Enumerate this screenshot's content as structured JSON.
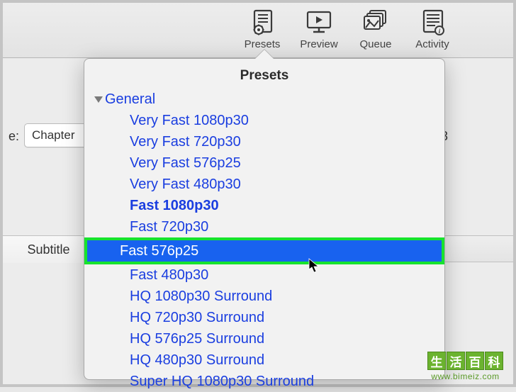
{
  "toolbar": {
    "items": [
      {
        "label": "Presets"
      },
      {
        "label": "Preview"
      },
      {
        "label": "Queue"
      },
      {
        "label": "Activity"
      }
    ]
  },
  "background": {
    "field_label": "e:",
    "chapter_label": "Chapter",
    "right_value": "3",
    "tab_label": "Subtitle"
  },
  "popover": {
    "title": "Presets",
    "category": "General",
    "items": [
      {
        "label": "Very Fast 1080p30",
        "bold": false,
        "selected": false
      },
      {
        "label": "Very Fast 720p30",
        "bold": false,
        "selected": false
      },
      {
        "label": "Very Fast 576p25",
        "bold": false,
        "selected": false
      },
      {
        "label": "Very Fast 480p30",
        "bold": false,
        "selected": false
      },
      {
        "label": "Fast 1080p30",
        "bold": true,
        "selected": false
      },
      {
        "label": "Fast 720p30",
        "bold": false,
        "selected": false
      },
      {
        "label": "Fast 576p25",
        "bold": false,
        "selected": true
      },
      {
        "label": "Fast 480p30",
        "bold": false,
        "selected": false
      },
      {
        "label": "HQ 1080p30 Surround",
        "bold": false,
        "selected": false
      },
      {
        "label": "HQ 720p30 Surround",
        "bold": false,
        "selected": false
      },
      {
        "label": "HQ 576p25 Surround",
        "bold": false,
        "selected": false
      },
      {
        "label": "HQ 480p30 Surround",
        "bold": false,
        "selected": false
      },
      {
        "label": "Super HQ 1080p30 Surround",
        "bold": false,
        "selected": false
      }
    ]
  },
  "watermark": {
    "chars": [
      "生",
      "活",
      "百",
      "科"
    ],
    "url": "www.bimeiz.com"
  }
}
